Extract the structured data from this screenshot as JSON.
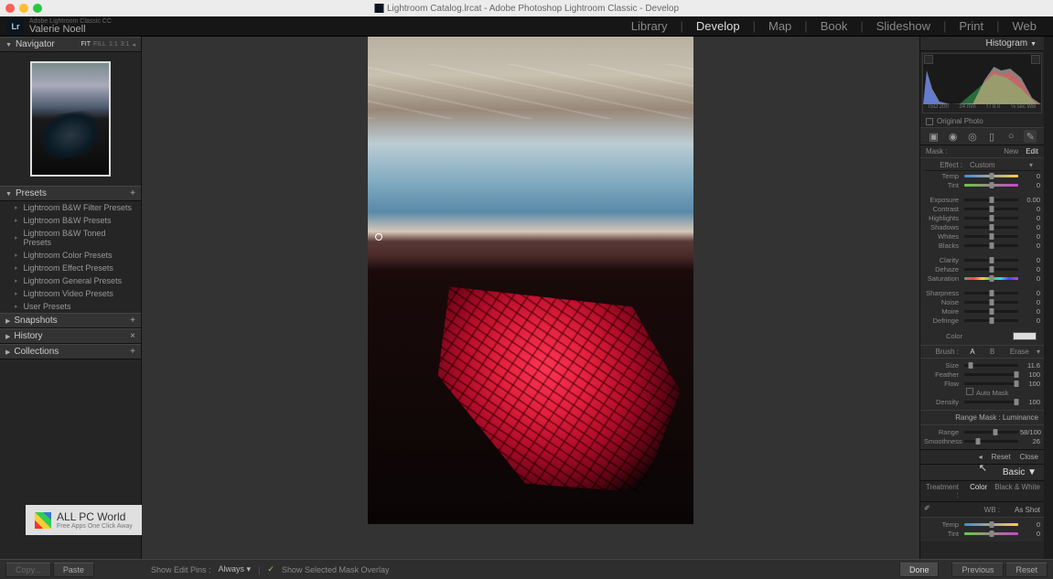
{
  "window": {
    "title": "Lightroom Catalog.lrcat - Adobe Photoshop Lightroom Classic - Develop"
  },
  "identity": {
    "app_sub": "Adobe Lightroom Classic CC",
    "user": "Valerie Noell"
  },
  "modules": {
    "items": [
      "Library",
      "Develop",
      "Map",
      "Book",
      "Slideshow",
      "Print",
      "Web"
    ],
    "active": "Develop"
  },
  "left": {
    "navigator": {
      "title": "Navigator",
      "opts": [
        "FIT",
        "FILL",
        "1:1",
        "3:1"
      ]
    },
    "presets": {
      "title": "Presets",
      "items": [
        "Lightroom B&W Filter Presets",
        "Lightroom B&W Presets",
        "Lightroom B&W Toned Presets",
        "Lightroom Color Presets",
        "Lightroom Effect Presets",
        "Lightroom General Presets",
        "Lightroom Video Presets",
        "User Presets"
      ]
    },
    "snapshots": {
      "title": "Snapshots"
    },
    "history": {
      "title": "History"
    },
    "collections": {
      "title": "Collections"
    }
  },
  "right": {
    "histogram": {
      "title": "Histogram",
      "info": [
        "ISO 200",
        "24 mm",
        "f / 8.0",
        "⅛ sec WB"
      ],
      "original": "Original Photo"
    },
    "mask": {
      "label": "Mask :",
      "new": "New",
      "edit": "Edit"
    },
    "effect": {
      "label": "Effect :",
      "mode": "Custom",
      "rows1": [
        {
          "k": "Temp",
          "v": "0",
          "cls": "temp"
        },
        {
          "k": "Tint",
          "v": "0",
          "cls": "tint"
        }
      ],
      "rows2": [
        {
          "k": "Exposure",
          "v": "0.00"
        },
        {
          "k": "Contrast",
          "v": "0"
        },
        {
          "k": "Highlights",
          "v": "0"
        },
        {
          "k": "Shadows",
          "v": "0"
        },
        {
          "k": "Whites",
          "v": "0"
        },
        {
          "k": "Blacks",
          "v": "0"
        }
      ],
      "rows3": [
        {
          "k": "Clarity",
          "v": "0"
        },
        {
          "k": "Dehaze",
          "v": "0"
        },
        {
          "k": "Saturation",
          "v": "0",
          "cls": "sat"
        }
      ],
      "rows4": [
        {
          "k": "Sharpness",
          "v": "0"
        },
        {
          "k": "Noise",
          "v": "0"
        },
        {
          "k": "Moire",
          "v": "0"
        },
        {
          "k": "Defringe",
          "v": "0"
        }
      ],
      "color_label": "Color"
    },
    "brush": {
      "label": "Brush :",
      "opts": [
        "A",
        "B",
        "Erase"
      ],
      "rows": [
        {
          "k": "Size",
          "v": "11.6",
          "pos": 12
        },
        {
          "k": "Feather",
          "v": "100",
          "pos": 96
        },
        {
          "k": "Flow",
          "v": "100",
          "pos": 96
        }
      ],
      "automask": "Auto Mask",
      "density": {
        "k": "Density",
        "v": "100",
        "pos": 96
      }
    },
    "rangemask": {
      "title": "Range Mask : Luminance",
      "rows": [
        {
          "k": "Range",
          "v": "58/100",
          "pos": 58
        },
        {
          "k": "Smoothness",
          "v": "26",
          "pos": 26
        }
      ]
    },
    "close": {
      "reset": "Reset",
      "close": "Close"
    },
    "basic": {
      "title": "Basic",
      "treatment": {
        "label": "Treatment :",
        "opts": [
          "Color",
          "Black & White"
        ],
        "sel": "Color"
      },
      "wb": {
        "label": "WB :",
        "value": "As Shot"
      },
      "rows": [
        {
          "k": "Temp",
          "v": "0",
          "cls": "temp"
        },
        {
          "k": "Tint",
          "v": "0",
          "cls": "tint"
        }
      ]
    }
  },
  "bottom": {
    "copy": "Copy...",
    "paste": "Paste",
    "showpins": "Show Edit Pins :",
    "always": "Always",
    "overlay": "Show Selected Mask Overlay",
    "done": "Done",
    "previous": "Previous",
    "reset": "Reset"
  },
  "watermark": {
    "title": "ALL PC World",
    "sub": "Free Apps One Click Away"
  }
}
